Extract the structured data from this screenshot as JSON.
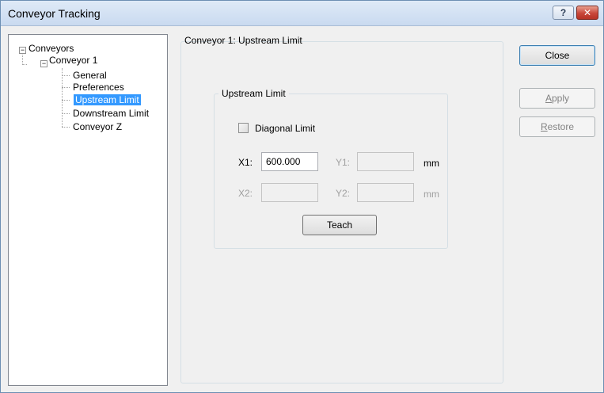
{
  "window": {
    "title": "Conveyor Tracking",
    "help_label": "?",
    "close_label": "✕"
  },
  "tree": {
    "root": "Conveyors",
    "conveyor1": "Conveyor 1",
    "children": [
      "General",
      "Preferences",
      "Upstream Limit",
      "Downstream Limit"
    ],
    "sibling": "Conveyor Z",
    "toggle_expanded": "−"
  },
  "page": {
    "group_title": "Conveyor 1: Upstream Limit",
    "section_title": "Upstream Limit",
    "diagonal_label": "Diagonal Limit",
    "x1_label": "X1:",
    "x1_value": "600.000",
    "y1_label": "Y1:",
    "y1_value": "",
    "unit1": "mm",
    "x2_label": "X2:",
    "x2_value": "",
    "y2_label": "Y2:",
    "y2_value": "",
    "unit2": "mm",
    "teach_label": "Teach"
  },
  "buttons": {
    "close_label": "Close",
    "apply_mnemonic": "A",
    "apply_rest": "pply",
    "restore_mnemonic": "R",
    "restore_rest": "estore"
  }
}
